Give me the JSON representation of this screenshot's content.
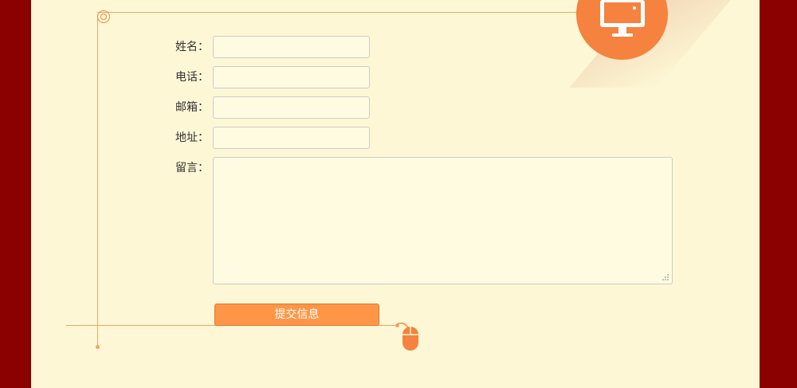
{
  "form": {
    "fields": [
      {
        "label": "姓名：",
        "value": ""
      },
      {
        "label": "电话：",
        "value": ""
      },
      {
        "label": "邮箱：",
        "value": ""
      },
      {
        "label": "地址：",
        "value": ""
      }
    ],
    "message": {
      "label": "留言：",
      "value": ""
    },
    "submit_label": "提交信息"
  },
  "colors": {
    "outer_background": "#8b0000",
    "panel_background": "#fdf7d5",
    "accent": "#f5823e",
    "button": "#ff9647",
    "line": "#f0a766"
  },
  "icons": [
    "monitor-icon",
    "mouse-icon",
    "target-icon"
  ]
}
